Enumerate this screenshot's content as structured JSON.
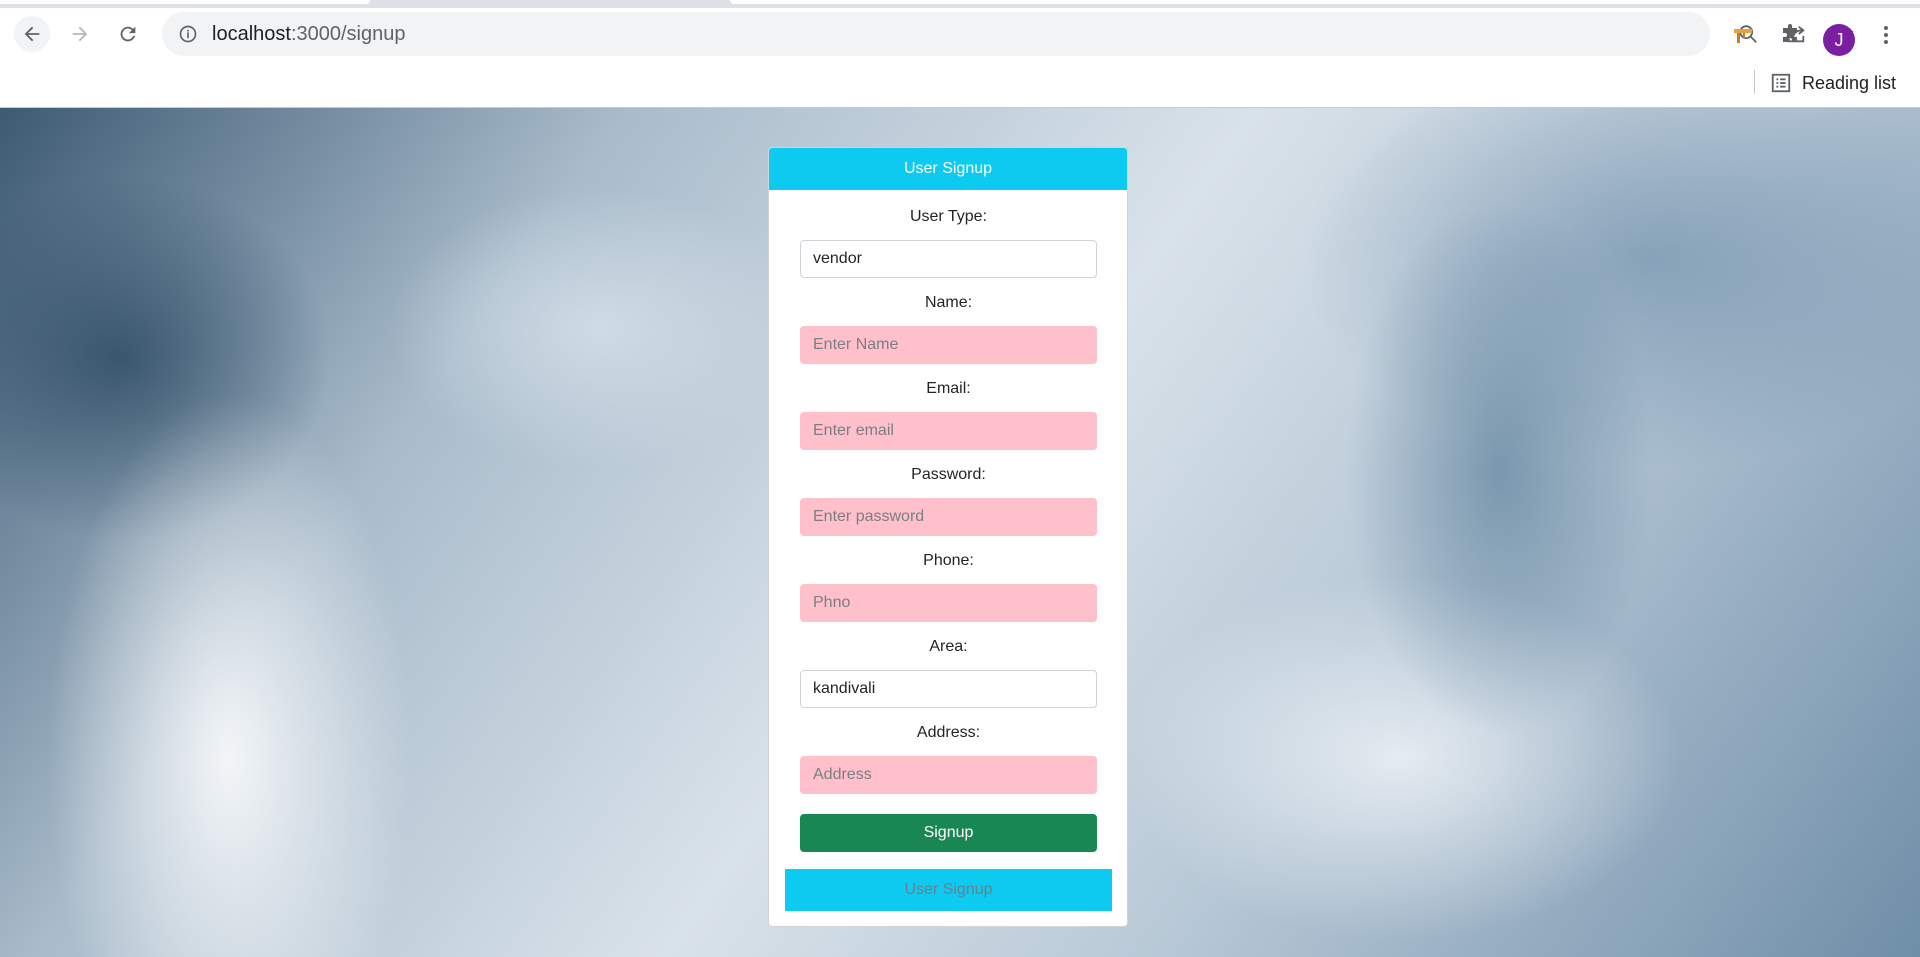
{
  "browser": {
    "url_host": "localhost",
    "url_path": ":3000/signup",
    "profile_initial": "J",
    "reading_list_label": "Reading list"
  },
  "colors": {
    "header_accent": "#0dcaf0",
    "signup_button": "#198754",
    "empty_field": "#ffc0cb",
    "avatar": "#7b1fa2"
  },
  "form": {
    "header_title": "User Signup",
    "fields": [
      {
        "label": "User Type:",
        "value": "vendor",
        "placeholder": ""
      },
      {
        "label": "Name:",
        "value": "",
        "placeholder": "Enter Name"
      },
      {
        "label": "Email:",
        "value": "",
        "placeholder": "Enter email"
      },
      {
        "label": "Password:",
        "value": "",
        "placeholder": "Enter password"
      },
      {
        "label": "Phone:",
        "value": "",
        "placeholder": "Phno"
      },
      {
        "label": "Area:",
        "value": "kandivali",
        "placeholder": ""
      },
      {
        "label": "Address:",
        "value": "",
        "placeholder": "Address"
      }
    ],
    "submit_label": "Signup",
    "footer_title": "User Signup"
  }
}
